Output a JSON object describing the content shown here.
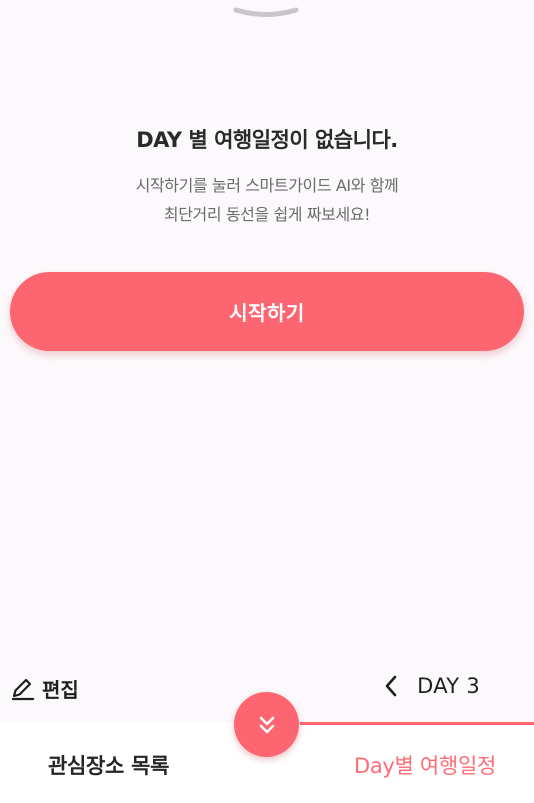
{
  "empty_state": {
    "title": "DAY 별 여행일정이 없습니다.",
    "description_lines": [
      "시작하기를 눌러 스마트가이드 AI와 함께",
      "최단거리 동선을 쉽게 짜보세요!"
    ],
    "start_button_label": "시작하기"
  },
  "toolbar": {
    "edit_label": "편집",
    "edit_icon": "pencil-icon",
    "prev_icon": "chevron-left-icon",
    "day_label": "DAY 3"
  },
  "tabs": [
    {
      "label": "관심장소 목록",
      "active": false
    },
    {
      "label": "Day별 여행일정",
      "active": true
    }
  ],
  "fab": {
    "icon": "double-chevron-down-icon"
  },
  "colors": {
    "accent": "#fd6571",
    "active_tab_text": "#ff6c75",
    "background": "#fcf9fc"
  }
}
